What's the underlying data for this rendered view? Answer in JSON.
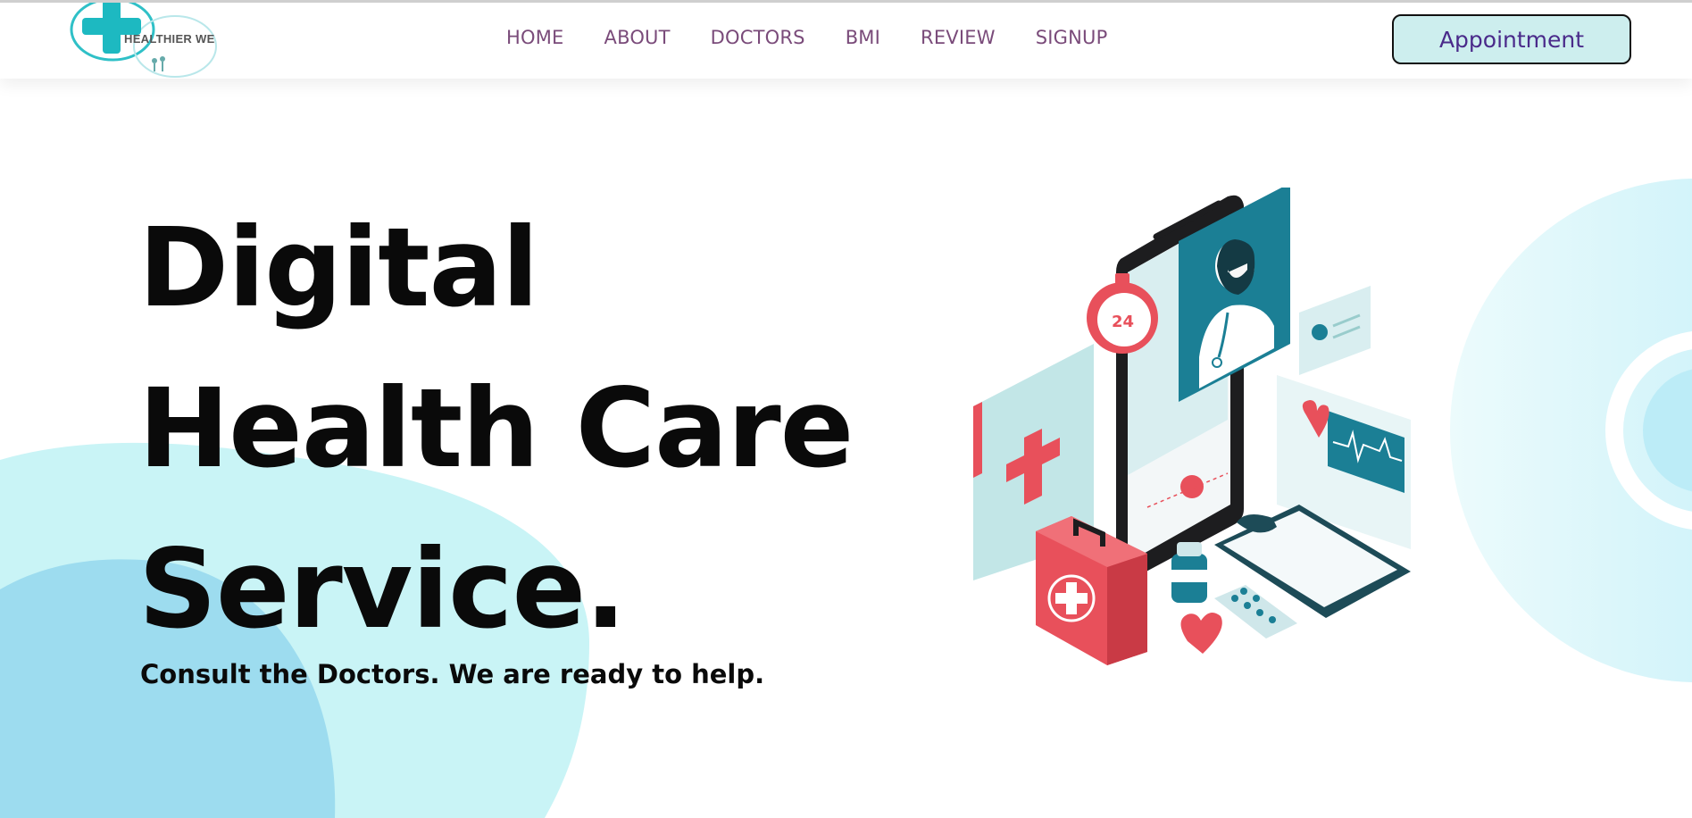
{
  "brand": {
    "logo_text": "HEALTHIER WE"
  },
  "nav": {
    "items": [
      "HOME",
      "ABOUT",
      "DOCTORS",
      "BMI",
      "REVIEW",
      "SIGNUP"
    ]
  },
  "header": {
    "appointment_label": "Appointment"
  },
  "hero": {
    "title_lines": [
      "Digital",
      "Health Care",
      "Service."
    ],
    "subtitle": "Consult the Doctors. We are ready to help."
  },
  "illustration": {
    "clock_label": "24"
  },
  "colors": {
    "nav_text": "#7a4b7a",
    "button_bg": "#cdeeee",
    "button_text": "#4a2a8a",
    "blob_light": "#c9f4f6",
    "blob_mid": "#9ddcef",
    "accent_red": "#e8505b",
    "accent_teal": "#1b7f95"
  },
  "icons": [
    "medical-cross-logo-icon",
    "doctor-avatar-icon",
    "clock-icon",
    "heart-icon",
    "first-aid-kit-icon",
    "pill-bottle-icon",
    "clipboard-icon",
    "phone-icon"
  ]
}
